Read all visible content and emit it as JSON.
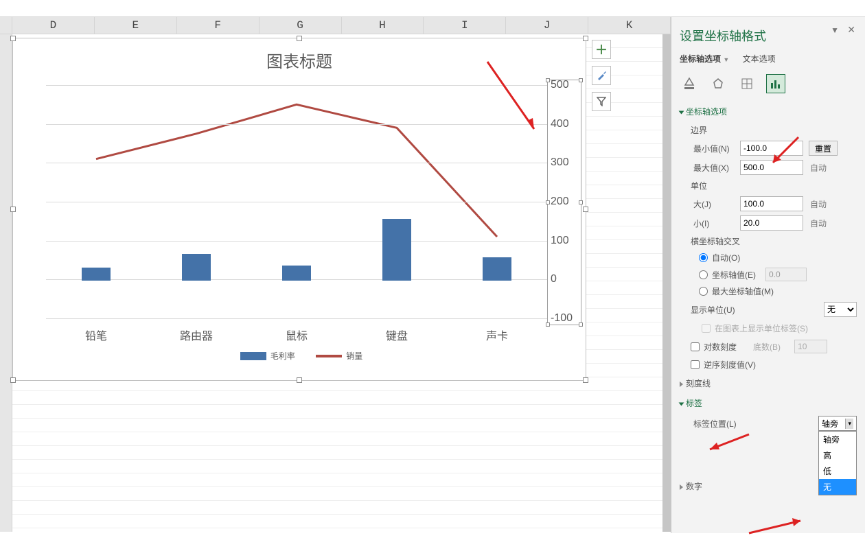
{
  "columns": [
    "D",
    "E",
    "F",
    "G",
    "H",
    "I",
    "J",
    "K"
  ],
  "chart_data": {
    "type": "bar+line",
    "title": "图表标题",
    "categories": [
      "铅笔",
      "路由器",
      "鼠标",
      "键盘",
      "声卡"
    ],
    "series": [
      {
        "name": "毛利率",
        "type": "bar",
        "values": [
          35,
          70,
          40,
          160,
          60
        ]
      },
      {
        "name": "销量",
        "type": "line",
        "values": [
          310,
          375,
          450,
          390,
          110
        ]
      }
    ],
    "ylim": [
      -100,
      500
    ],
    "ystep": 100,
    "legend": {
      "bar": "毛利率",
      "line": "销量"
    }
  },
  "side_buttons": {
    "add": "＋",
    "brush": "brush",
    "filter": "filter"
  },
  "pane": {
    "title": "设置坐标轴格式",
    "tabs": {
      "axis": "坐标轴选项",
      "text": "文本选项"
    },
    "sections": {
      "axis_options": "坐标轴选项",
      "bounds": "边界",
      "min": "最小值(N)",
      "min_val": "-100.0",
      "reset": "重置",
      "max": "最大值(X)",
      "max_val": "500.0",
      "auto": "自动",
      "units": "单位",
      "major": "大(J)",
      "major_val": "100.0",
      "minor": "小(I)",
      "minor_val": "20.0",
      "cross": "横坐标轴交叉",
      "cross_auto": "自动(O)",
      "cross_val": "坐标轴值(E)",
      "cross_val_num": "0.0",
      "cross_max": "最大坐标轴值(M)",
      "disp_unit": "显示单位(U)",
      "disp_unit_val": "无",
      "disp_unit_chk": "在图表上显示单位标签(S)",
      "log": "对数刻度",
      "log_base": "底数(B)",
      "log_base_val": "10",
      "reverse": "逆序刻度值(V)",
      "ticks": "刻度线",
      "labels": "标签",
      "label_pos": "标签位置(L)",
      "label_pos_val": "轴旁",
      "label_options": [
        "轴旁",
        "高",
        "低",
        "无"
      ],
      "numbers": "数字"
    }
  }
}
